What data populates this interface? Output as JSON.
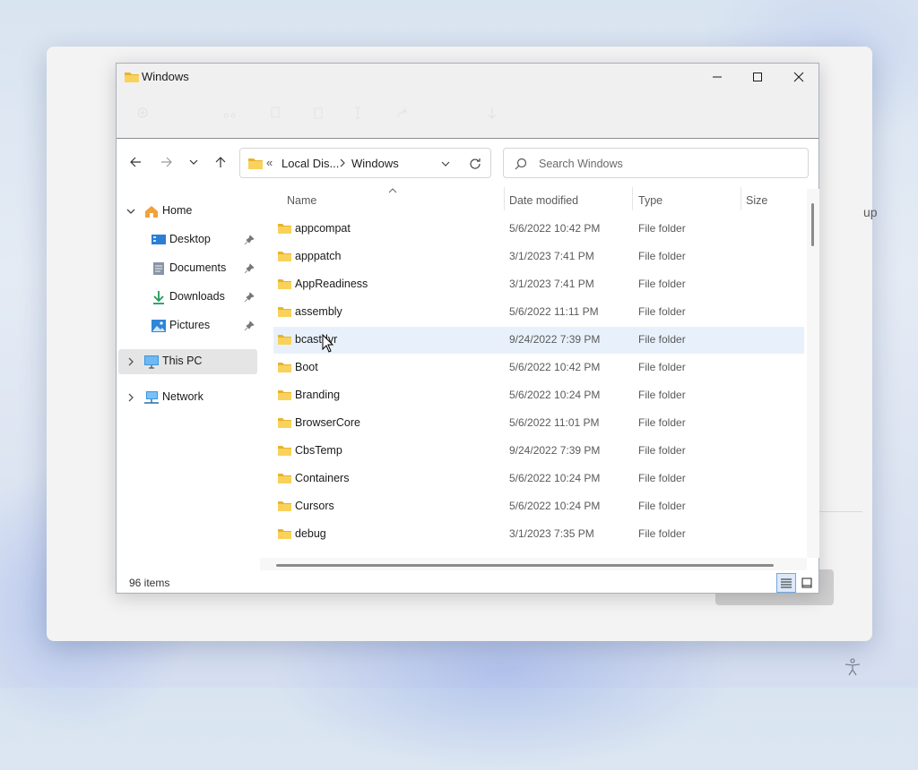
{
  "window": {
    "title": "Windows",
    "controls": {
      "minimize": "minimize-icon",
      "maximize": "maximize-icon",
      "close": "close-icon"
    }
  },
  "background": {
    "partial_text": "up"
  },
  "address": {
    "overflow": "«",
    "crumb1": "Local Dis...",
    "crumb2": "Windows"
  },
  "search": {
    "placeholder": "Search Windows"
  },
  "sidebar": {
    "items": [
      {
        "label": "Home",
        "icon": "home-icon",
        "expanded": true
      },
      {
        "label": "Desktop",
        "icon": "desktop-icon",
        "pinned": true
      },
      {
        "label": "Documents",
        "icon": "documents-icon",
        "pinned": true
      },
      {
        "label": "Downloads",
        "icon": "downloads-icon",
        "pinned": true
      },
      {
        "label": "Pictures",
        "icon": "pictures-icon",
        "pinned": true
      },
      {
        "label": "This PC",
        "icon": "this-pc-icon",
        "selected": true
      },
      {
        "label": "Network",
        "icon": "network-icon"
      }
    ]
  },
  "columns": [
    "Name",
    "Date modified",
    "Type",
    "Size"
  ],
  "files": [
    {
      "name": "appcompat",
      "date": "5/6/2022 10:42 PM",
      "type": "File folder"
    },
    {
      "name": "apppatch",
      "date": "3/1/2023 7:41 PM",
      "type": "File folder"
    },
    {
      "name": "AppReadiness",
      "date": "3/1/2023 7:41 PM",
      "type": "File folder"
    },
    {
      "name": "assembly",
      "date": "5/6/2022 11:11 PM",
      "type": "File folder"
    },
    {
      "name": "bcastdvr",
      "date": "9/24/2022 7:39 PM",
      "type": "File folder",
      "hover": true
    },
    {
      "name": "Boot",
      "date": "5/6/2022 10:42 PM",
      "type": "File folder"
    },
    {
      "name": "Branding",
      "date": "5/6/2022 10:24 PM",
      "type": "File folder"
    },
    {
      "name": "BrowserCore",
      "date": "5/6/2022 11:01 PM",
      "type": "File folder"
    },
    {
      "name": "CbsTemp",
      "date": "9/24/2022 7:39 PM",
      "type": "File folder"
    },
    {
      "name": "Containers",
      "date": "5/6/2022 10:24 PM",
      "type": "File folder"
    },
    {
      "name": "Cursors",
      "date": "5/6/2022 10:24 PM",
      "type": "File folder"
    },
    {
      "name": "debug",
      "date": "3/1/2023 7:35 PM",
      "type": "File folder"
    }
  ],
  "status": {
    "item_count": "96 items"
  },
  "colors": {
    "folder": "#f4c542",
    "hover_row": "#e8f1fb",
    "selected_nav": "#e5e5e5",
    "accent": "#0067c0"
  }
}
